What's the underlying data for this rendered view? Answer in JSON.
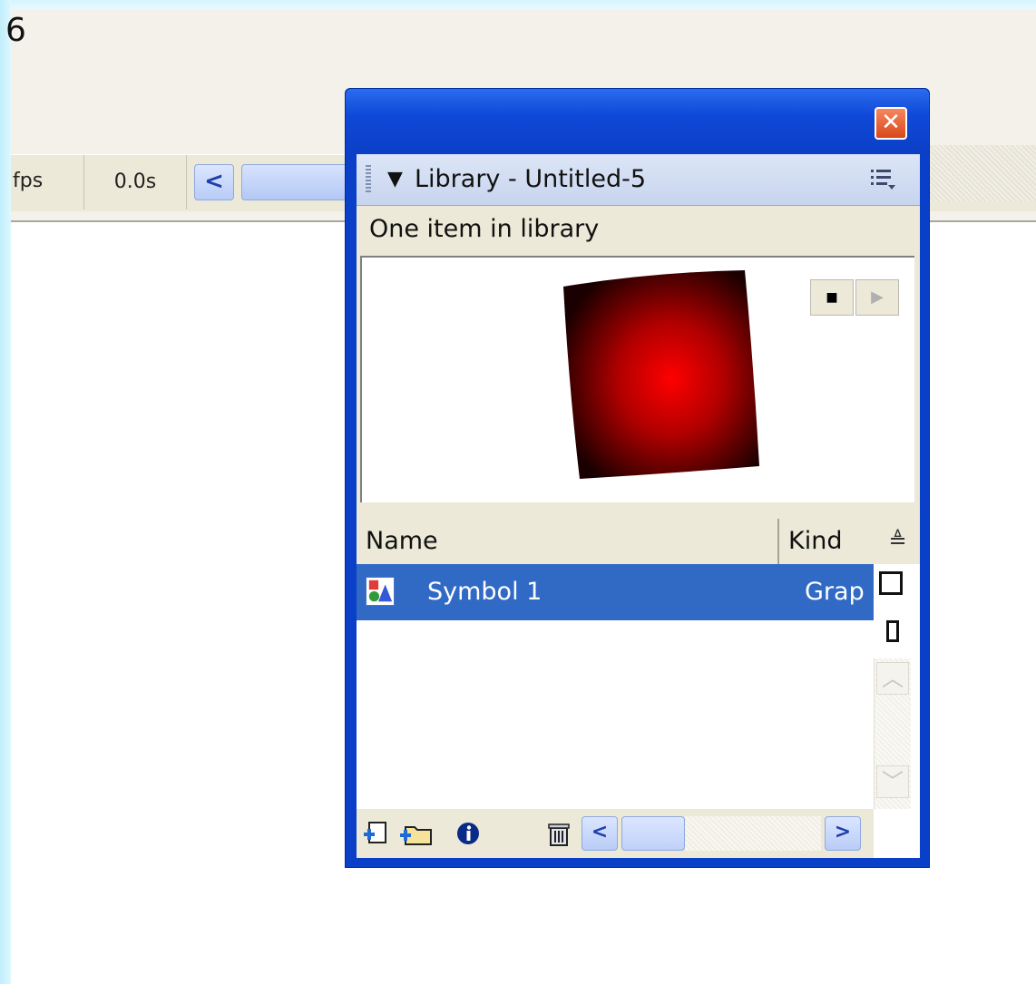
{
  "background": {
    "corner_char": "6",
    "timeline": {
      "fps_label": "fps",
      "time_value": "0.0s",
      "scroll_left_glyph": "<"
    }
  },
  "library_panel": {
    "close_glyph": "✕",
    "header": {
      "collapse_glyph": "▼",
      "title": "Library - Untitled-5"
    },
    "item_count_text": "One item in library",
    "preview": {
      "stop_glyph": "■",
      "play_glyph": "▶",
      "shape_color": "#ff0000"
    },
    "columns": {
      "name": "Name",
      "kind": "Kind",
      "sort_glyph": "≜"
    },
    "items": [
      {
        "name": "Symbol 1",
        "kind": "Graphic",
        "kind_visible": "Grap"
      }
    ],
    "scroll": {
      "up_glyph": "︿",
      "down_glyph": "﹀",
      "left_glyph": "<",
      "right_glyph": ">"
    },
    "colors": {
      "window_blue": "#0a3fc7",
      "selection": "#316ac5",
      "panel_bg": "#ece9d8"
    }
  }
}
